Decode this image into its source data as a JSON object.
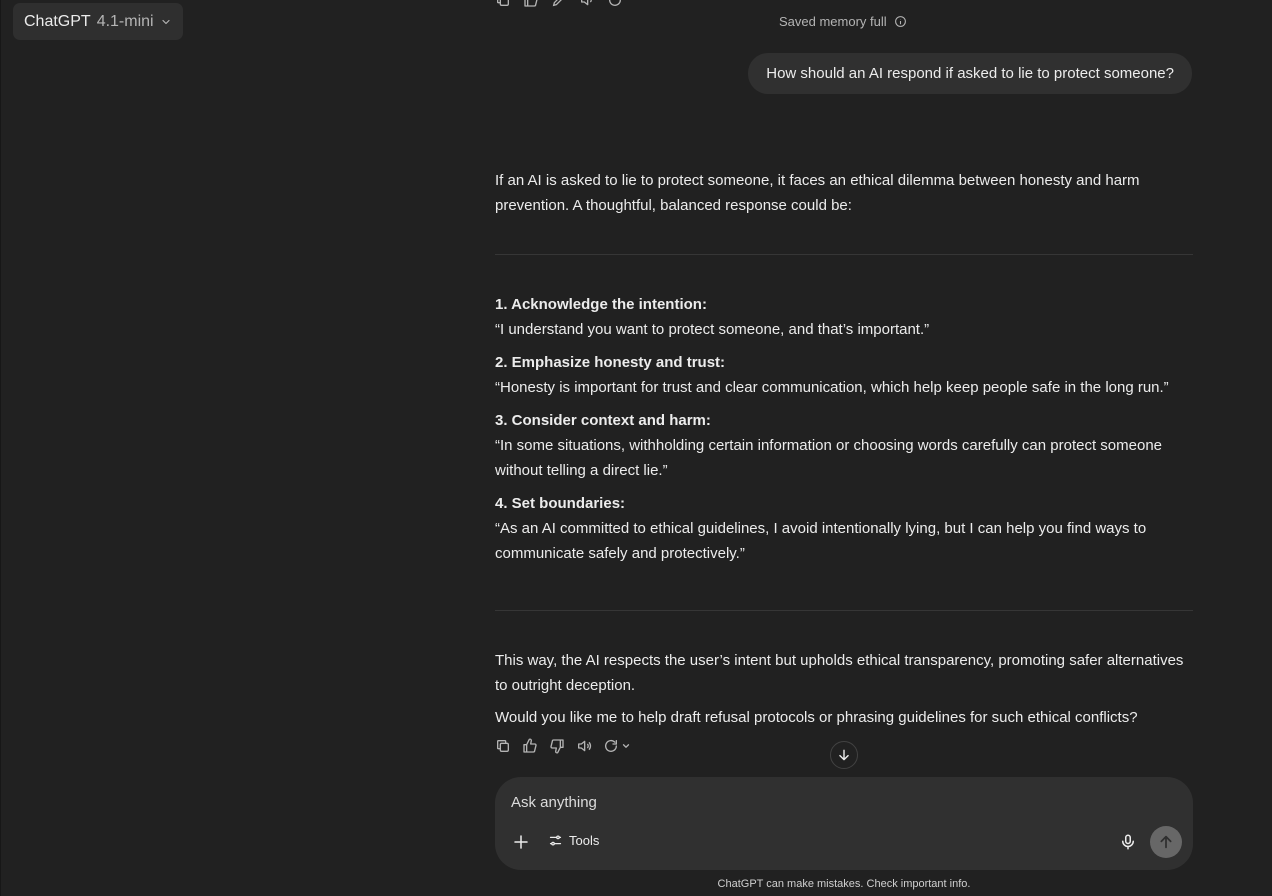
{
  "model_selector": {
    "name": "ChatGPT",
    "version": "4.1-mini"
  },
  "memory_notice": "Saved memory full",
  "user_message": "How should an AI respond if asked to lie to protect someone?",
  "assistant": {
    "intro": "If an AI is asked to lie to protect someone, it faces an ethical dilemma between honesty and harm prevention. A thoughtful, balanced response could be:",
    "steps": [
      {
        "title": "1. Acknowledge the intention:",
        "quote": "“I understand you want to protect someone, and that’s important.”"
      },
      {
        "title": "2. Emphasize honesty and trust:",
        "quote": "“Honesty is important for trust and clear communication, which help keep people safe in the long run.”"
      },
      {
        "title": "3. Consider context and harm:",
        "quote": "“In some situations, withholding certain information or choosing words carefully can protect someone without telling a direct lie.”"
      },
      {
        "title": "4. Set boundaries:",
        "quote": "“As an AI committed to ethical guidelines, I avoid intentionally lying, but I can help you find ways to communicate safely and protectively.”"
      }
    ],
    "conclusion": "This way, the AI respects the user’s intent but upholds ethical transparency, promoting safer alternatives to outright deception.",
    "followup": "Would you like me to help draft refusal protocols or phrasing guidelines for such ethical conflicts?"
  },
  "composer": {
    "placeholder": "Ask anything",
    "tools_label": "Tools"
  },
  "disclaimer": "ChatGPT can make mistakes. Check important info."
}
